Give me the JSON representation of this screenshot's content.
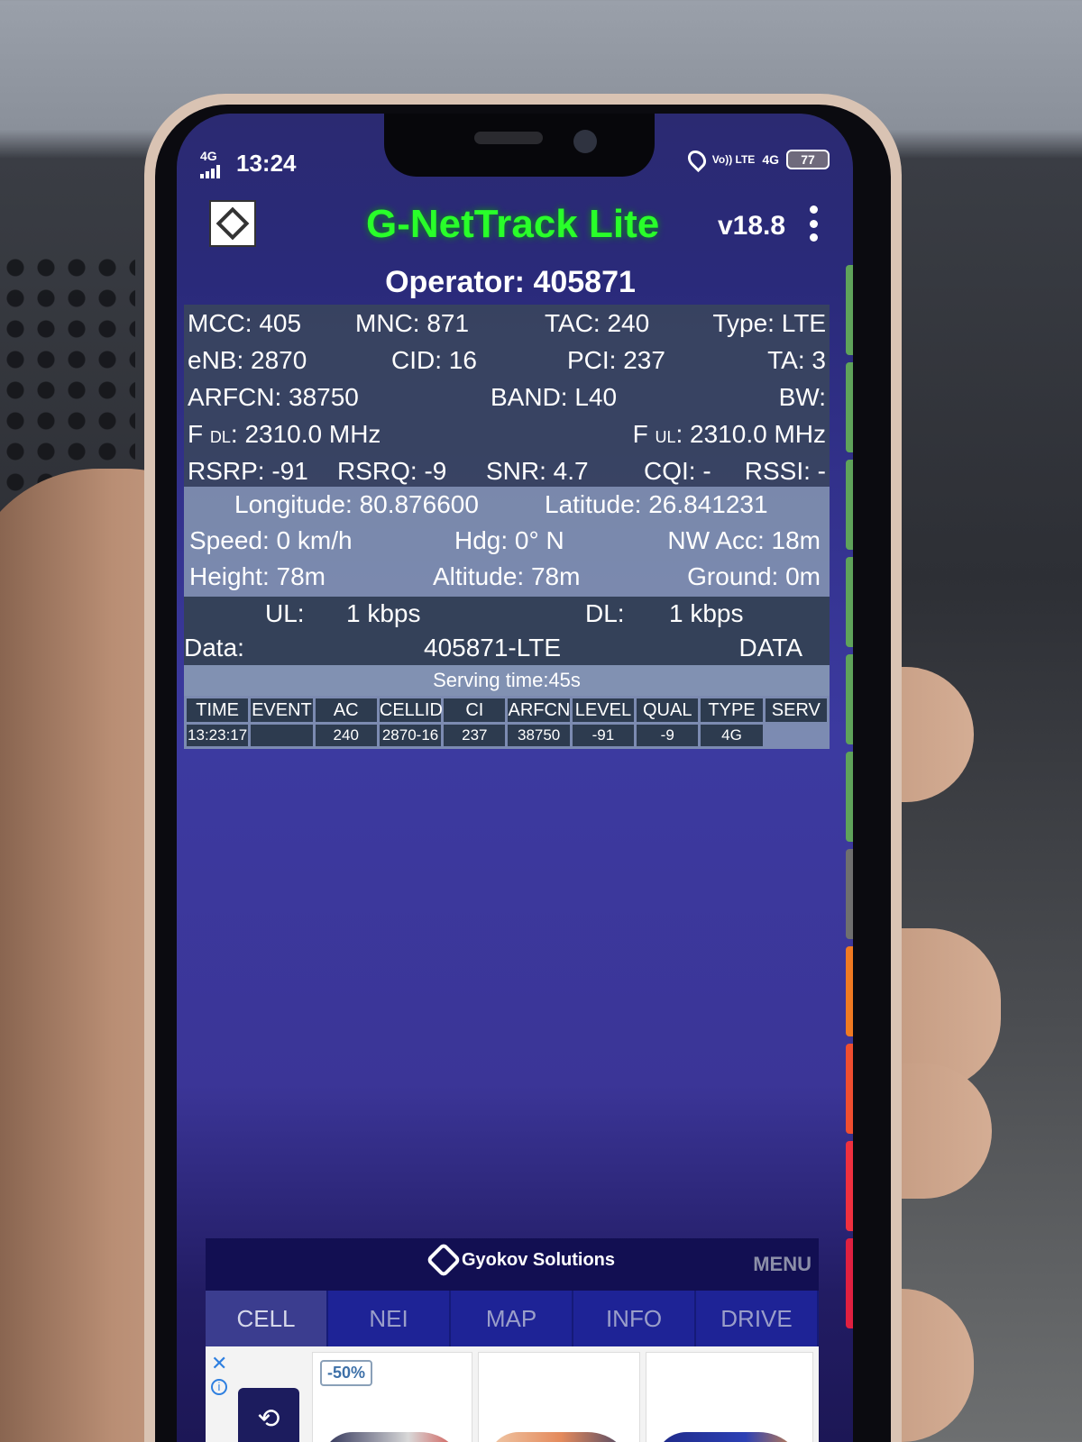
{
  "status_bar": {
    "network": "4G",
    "time": "13:24",
    "volte": "Vo)) LTE",
    "net_type": "4G",
    "battery": "77"
  },
  "app": {
    "title": "G-NetTrack Lite",
    "version": "v18.8",
    "icons": [
      "app-logo-icon",
      "kebab-menu-icon"
    ]
  },
  "operator": "Operator: 405871",
  "cell": {
    "mcc": "MCC: 405",
    "mnc": "MNC: 871",
    "tac": "TAC: 240",
    "type": "Type: LTE",
    "enb": "eNB: 2870",
    "cid": "CID: 16",
    "pci": "PCI: 237",
    "ta": "TA: 3",
    "arfcn": "ARFCN: 38750",
    "band": "BAND: L40",
    "bw": "BW:",
    "fdl_prefix": "F",
    "fdl_sub": "DL",
    "fdl_value": ": 2310.0 MHz",
    "ful_prefix": "F",
    "ful_sub": "UL",
    "ful_value": ": 2310.0 MHz",
    "rsrp": "RSRP: -91",
    "rsrq": "RSRQ: -9",
    "snr": "SNR: 4.7",
    "cqi": "CQI: -",
    "rssi": "RSSI: -"
  },
  "gps": {
    "longitude": "Longitude: 80.876600",
    "latitude": "Latitude: 26.841231",
    "speed": "Speed: 0 km/h",
    "heading": "Hdg: 0° N",
    "nw_acc": "NW Acc: 18m",
    "height": "Height: 78m",
    "altitude": "Altitude: 78m",
    "ground": "Ground: 0m"
  },
  "throughput": {
    "ul_label": "UL:",
    "ul_value": "1 kbps",
    "dl_label": "DL:",
    "dl_value": "1 kbps",
    "data_label": "Data:",
    "data_network": "405871-LTE",
    "data_state": "DATA"
  },
  "serving_time": "Serving time:45s",
  "log_table": {
    "headers": [
      "TIME",
      "EVENT",
      "AC",
      "CELLID",
      "CI",
      "ARFCN",
      "LEVEL",
      "QUAL",
      "TYPE",
      "SERV"
    ],
    "rows": [
      [
        "13:23:17",
        "",
        "240",
        "2870-16",
        "237",
        "38750",
        "-91",
        "-9",
        "4G",
        ""
      ]
    ]
  },
  "signal_meter": {
    "colors": [
      "#5fa35a",
      "#5fa35a",
      "#5fa35a",
      "#5fa35a",
      "#5fa35a",
      "#5fa35a",
      "#6f6f6f",
      "#f07a22",
      "#f04e30",
      "#f0303f",
      "#e02040"
    ]
  },
  "brand": {
    "name": "Gyokov Solutions",
    "menu": "MENU"
  },
  "tabs": [
    "CELL",
    "NEI",
    "MAP",
    "INFO",
    "DRIVE"
  ],
  "active_tab": "CELL",
  "ad": {
    "close": "✕",
    "info": "i",
    "discount": "-50%"
  }
}
